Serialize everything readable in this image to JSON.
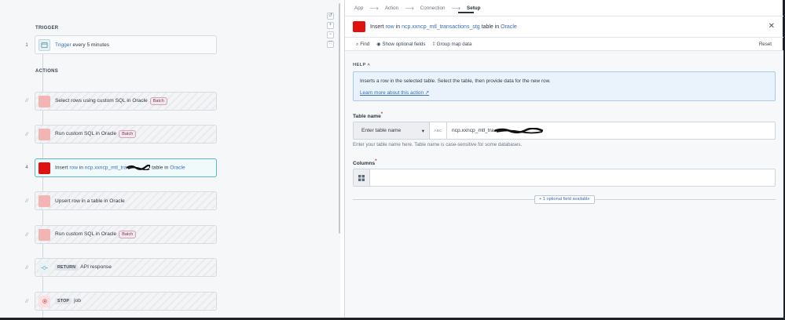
{
  "canvas": {
    "trigger_section": "TRIGGER",
    "actions_section": "ACTIONS",
    "trigger": {
      "num": "1",
      "label": "Trigger",
      "suffix": " every 5 minutes"
    },
    "steps": [
      {
        "num": "//",
        "prefix": "Select rows using custom SQL in ",
        "app": "Oracle",
        "badge": "Batch"
      },
      {
        "num": "//",
        "prefix": "Run custom SQL in ",
        "app": "Oracle",
        "badge": "Batch"
      },
      {
        "num": "4",
        "prefix": "Insert ",
        "kw": "row",
        "mid": " in ",
        "obj": "ncp.xxncp_mtl_tra",
        "tail": " table in ",
        "app": "Oracle"
      },
      {
        "num": "//",
        "prefix": "Upsert row in a table in ",
        "app": "Oracle"
      },
      {
        "num": "//",
        "prefix": "Run custom SQL in ",
        "app": "Oracle",
        "badge": "Batch"
      },
      {
        "num": "//",
        "kw": "RETURN",
        "label": "API response"
      },
      {
        "num": "//",
        "kw": "STOP",
        "label": "job"
      }
    ]
  },
  "panel": {
    "breadcrumbs": [
      "App",
      "Action",
      "Connection",
      "Setup"
    ],
    "header": {
      "insert": "Insert ",
      "row": "row",
      "in": " in ",
      "object": "ncp.xxncp_mtl_transactions_stg",
      "table_in": " table in ",
      "app": "Oracle"
    },
    "toolbar": {
      "find": "Find",
      "optional": "Show optional fields",
      "group": "Group map data",
      "reset": "Reset"
    },
    "help": {
      "label": "HELP",
      "text": "Inserts a row in the selected table. Select the table, then provide data for the new row.",
      "link": "Learn more about this action"
    },
    "table_name": {
      "label": "Table name",
      "select": "Enter table name",
      "type_tag": "ABC",
      "value": "ncp.xxncp_mtl_tra",
      "hint": "Enter your table name here. Table name is case-sensitive for some databases."
    },
    "columns": {
      "label": "Columns"
    },
    "optional": "+ 1 optional field available"
  },
  "colors": {
    "oracle": "#e0120f",
    "accent": "#5bb8c6",
    "link": "#3a6db3"
  }
}
